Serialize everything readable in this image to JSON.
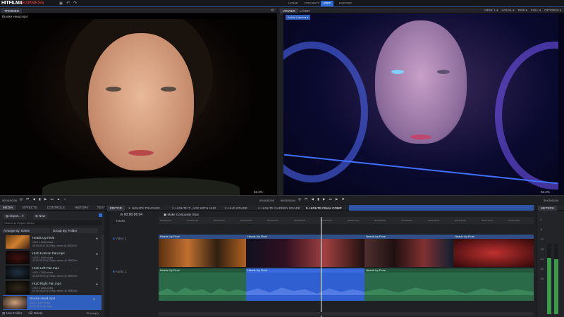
{
  "app": {
    "logo_main": "HITFILM4",
    "logo_sub": "EXPRESS"
  },
  "nav": {
    "tabs": [
      "HOME",
      "PROJECT",
      "EDIT",
      "EXPORT"
    ],
    "active": "EDIT"
  },
  "trimmer": {
    "tab": "TRIMMER",
    "file": "Brooke Head.mp4",
    "timecode": "00:00:00:00",
    "zoom": "82.2%",
    "end_time": "00:00:00:00"
  },
  "viewer": {
    "tabs": [
      "VIEWER",
      "LAYER"
    ],
    "options": [
      "VIEW: 1 ▾",
      "LOCAL ▾",
      "RGB ▾",
      "FULL ▾",
      "OPTIONS ▾"
    ],
    "camera": "Active Camera ▾",
    "timecode": "00:00:06:04",
    "zoom": "82.2%",
    "end_time": "00:00:06:04"
  },
  "media_panel": {
    "tabs": [
      "MEDIA",
      "EFFECTS",
      "CONTROLS",
      "HISTORY",
      "TEXT"
    ],
    "import_label": "Import...",
    "new_label": "New",
    "search_placeholder": "Search in Project Media",
    "arrange": "Arrange By: Name",
    "group": "Group By: Folder",
    "items": [
      {
        "name": "Heads Up Final",
        "info1": "1920 x 1080 pixels",
        "info2": "00:00:05:11 @ 25fps, stereo @ 48000Hz"
      },
      {
        "name": "HUD Horizon Pan.mp4",
        "info1": "1920 x 1080 pixels",
        "info2": "00:00:05:00 @ 25fps, stereo @ 48000Hz"
      },
      {
        "name": "HUD Left Pan.mp4",
        "info1": "1920 x 1080 pixels",
        "info2": "00:00:05:00 @ 25fps, stereo @ 48000Hz"
      },
      {
        "name": "HUD Right Pan.mp4",
        "info1": "1920 x 1080 pixels",
        "info2": "00:00:05:00 @ 25fps, stereo @ 48000Hz"
      },
      {
        "name": "Brooke Head.mp4",
        "info1": "1920 x 1080 pixels",
        "info2": "00:00:05:00 @ 25fps"
      }
    ],
    "selected": 4,
    "new_folder": "New Folder",
    "delete": "Delete",
    "count": "11 Item(s)"
  },
  "editor": {
    "tabs": [
      "EDITOR",
      "1. HIGHTE TRACKED",
      "2. HIGHTE T...ACE WITH HUD",
      "3. HUD GRADE",
      "4. HIGHTE GARDEN GRADE",
      "5. HIGHTE FINAL COMP"
    ],
    "timecode": "00:00:06:04",
    "make_composite": "Make Composite Shot",
    "tracks_label": "Tracks",
    "video_track": "Video 1",
    "audio_track": "Audio 1",
    "ruler": [
      "00:00:00:00",
      "00:00:01:00",
      "00:00:02:00",
      "00:00:03:00",
      "00:00:04:00",
      "00:00:05:00",
      "00:00:06:00",
      "00:00:07:00",
      "00:00:08:00",
      "00:00:09:00",
      "00:00:10:00",
      "00:00:11:00",
      "00:00:12:00",
      "00:00:13:00"
    ],
    "clip_label": "Heads Up Final"
  },
  "meters": {
    "tab": "METERS",
    "scale": [
      "0",
      "-6",
      "-12",
      "-18",
      "-24",
      "-30",
      "-36"
    ]
  },
  "colors": {
    "accent": "#2f6bd8",
    "audio": "#2a6a48",
    "selected": "#2f5fbf"
  }
}
